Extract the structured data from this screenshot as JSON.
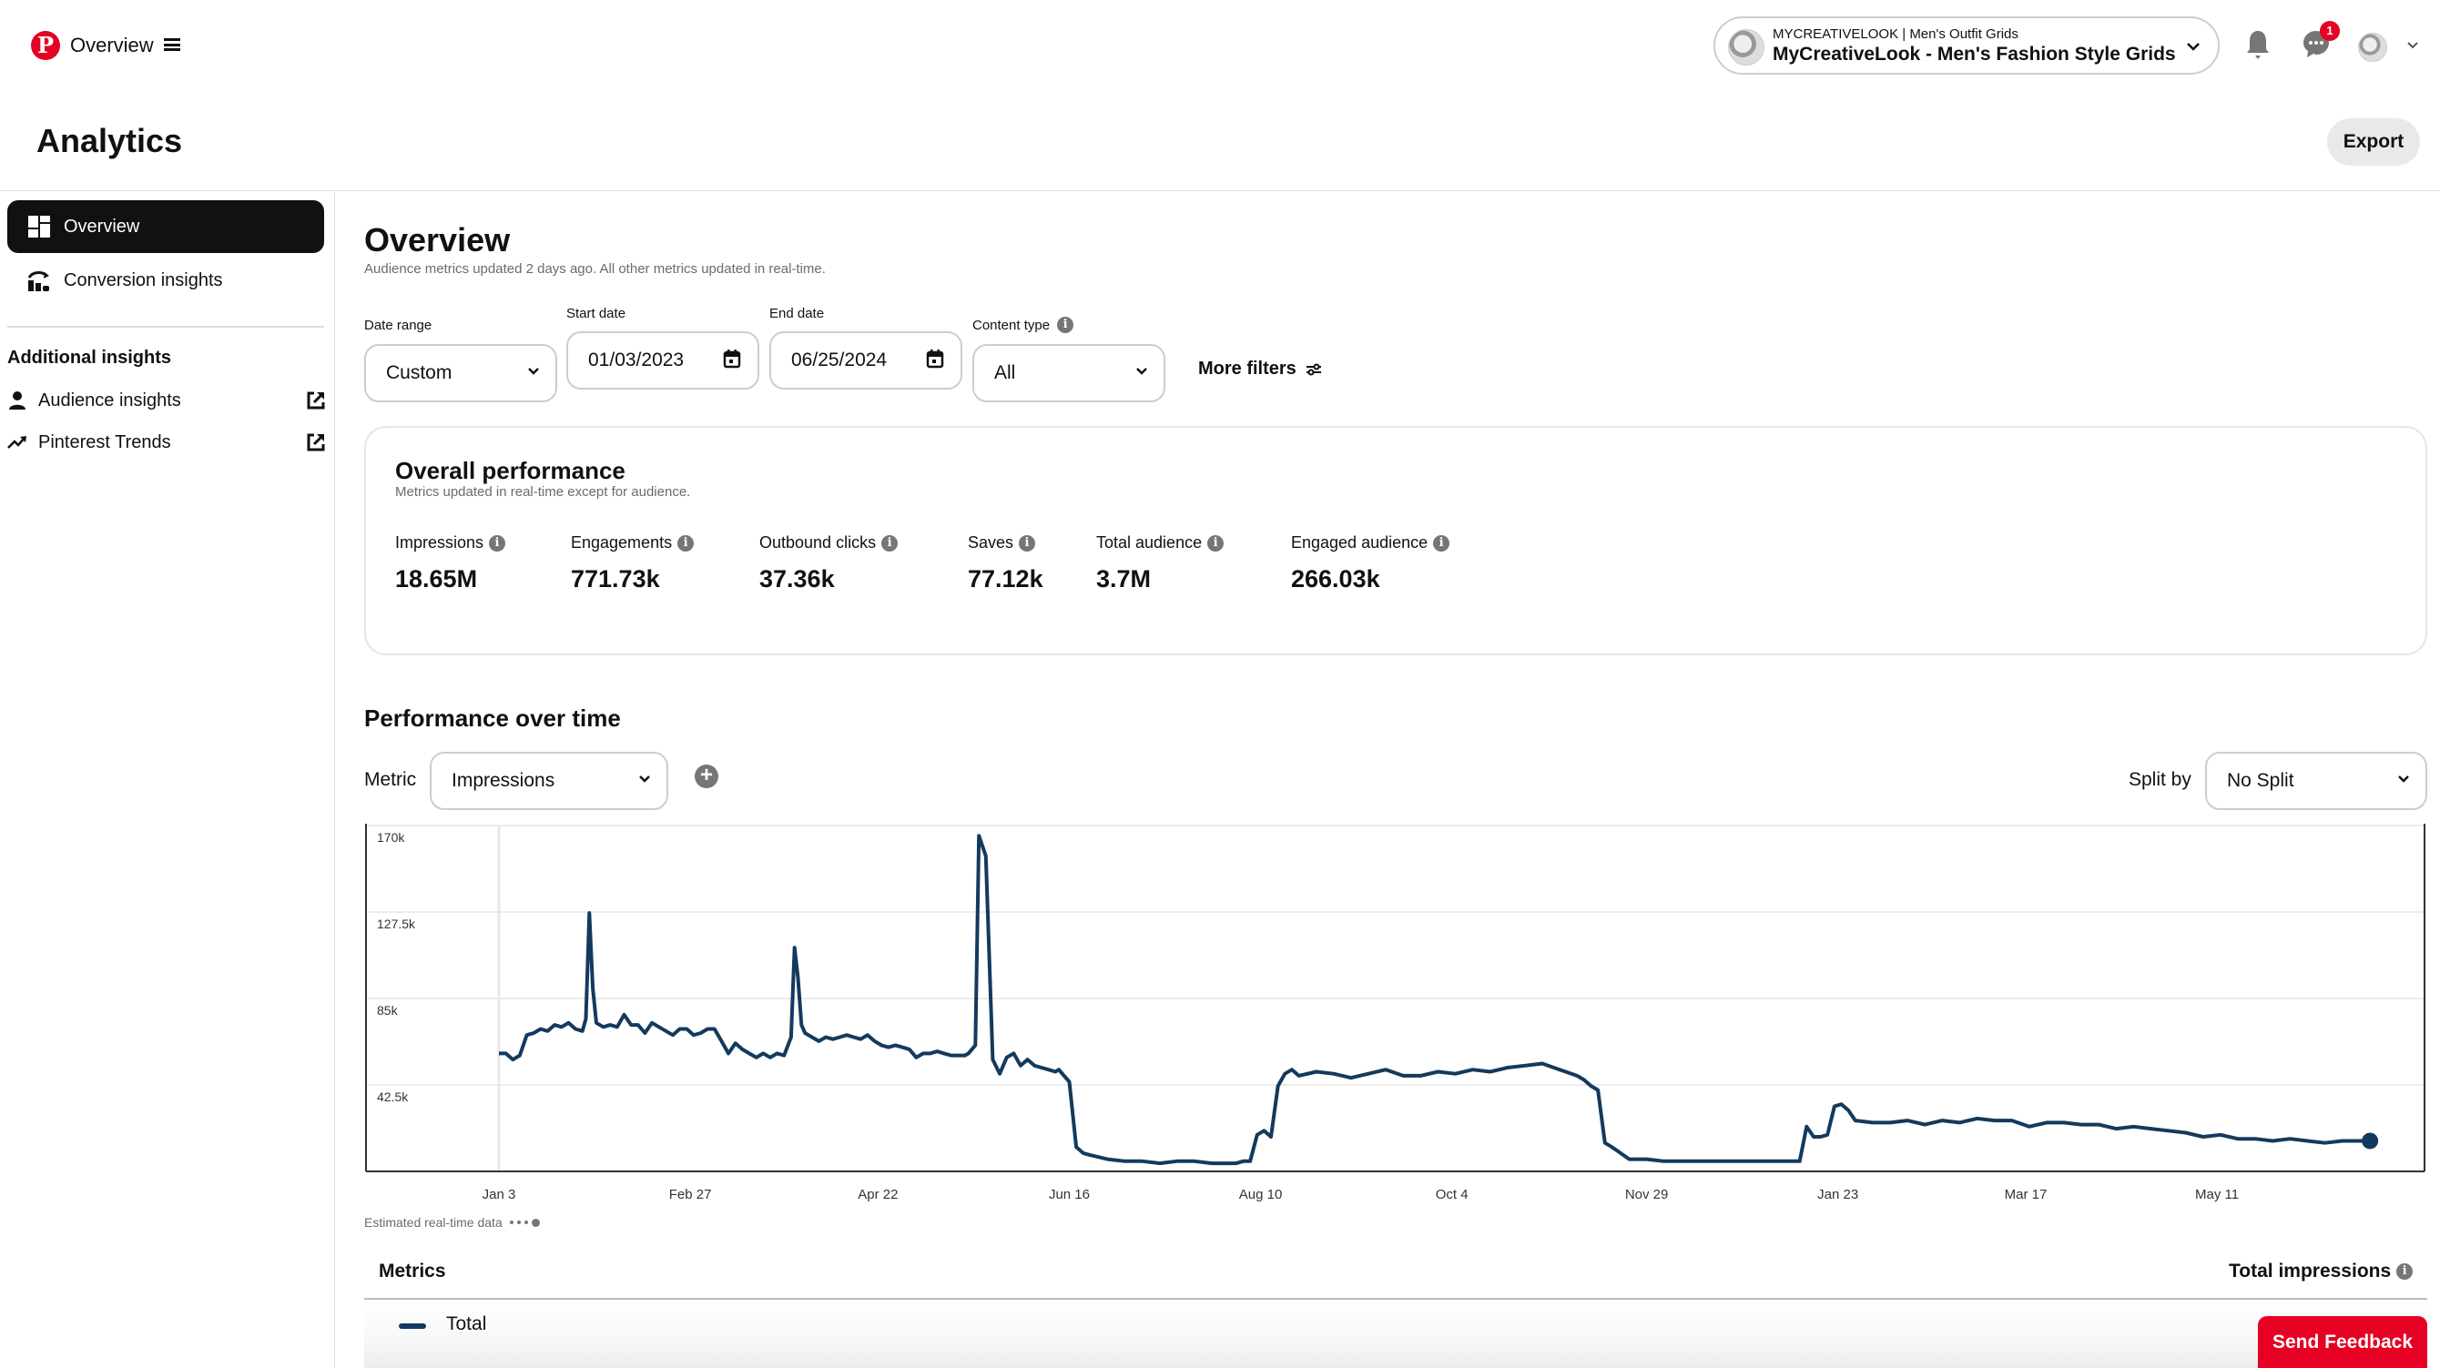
{
  "topbar": {
    "title": "Overview",
    "account": {
      "small": "MYCREATIVELOOK | Men's Outfit Grids",
      "name": "MyCreativeLook - Men's Fashion Style Grids"
    },
    "notification_badge": "1",
    "icons": [
      "pinterest-logo-icon",
      "menu-icon",
      "chevron-down-icon",
      "bell-icon",
      "chat-icon",
      "avatar"
    ]
  },
  "header": {
    "title": "Analytics",
    "export_label": "Export"
  },
  "sidebar": {
    "items": [
      {
        "label": "Overview",
        "icon": "dashboard-icon",
        "active": true
      },
      {
        "label": "Conversion insights",
        "icon": "conversion-icon",
        "active": false
      }
    ],
    "additional_heading": "Additional insights",
    "external": [
      {
        "label": "Audience insights",
        "icon": "person-icon"
      },
      {
        "label": "Pinterest Trends",
        "icon": "trend-icon"
      }
    ]
  },
  "main": {
    "title": "Overview",
    "subtitle": "Audience metrics updated 2 days ago. All other metrics updated in real-time.",
    "filters": {
      "date_range": {
        "label": "Date range",
        "value": "Custom"
      },
      "start_date": {
        "label": "Start date",
        "value": "01/03/2023"
      },
      "end_date": {
        "label": "End date",
        "value": "06/25/2024"
      },
      "content_type": {
        "label": "Content type",
        "value": "All"
      },
      "more_filters": "More filters"
    },
    "overall": {
      "title": "Overall performance",
      "subtitle": "Metrics updated in real-time except for audience.",
      "metrics": [
        {
          "label": "Impressions",
          "value": "18.65M"
        },
        {
          "label": "Engagements",
          "value": "771.73k"
        },
        {
          "label": "Outbound clicks",
          "value": "37.36k"
        },
        {
          "label": "Saves",
          "value": "77.12k"
        },
        {
          "label": "Total audience",
          "value": "3.7M"
        },
        {
          "label": "Engaged audience",
          "value": "266.03k"
        }
      ]
    },
    "performance": {
      "title": "Performance over time",
      "metric_label": "Metric",
      "metric_value": "Impressions",
      "split_label": "Split by",
      "split_value": "No Split",
      "estimated_note": "Estimated real-time data",
      "table": {
        "metrics_header": "Metrics",
        "total_header": "Total impressions",
        "rows": [
          {
            "label": "Total"
          }
        ]
      }
    },
    "feedback_label": "Send Feedback"
  },
  "colors": {
    "brand": "#e60023",
    "line": "#133a5e"
  },
  "chart_data": {
    "type": "line",
    "title": "Performance over time",
    "xlabel": "",
    "ylabel": "Impressions",
    "ylim": [
      0,
      170000
    ],
    "yticks": [
      "170k",
      "127.5k",
      "85k",
      "42.5k"
    ],
    "ytick_values": [
      170000,
      127500,
      85000,
      42500
    ],
    "xticks": [
      "Jan 3",
      "Feb 27",
      "Apr 22",
      "Jun 16",
      "Aug 10",
      "Oct 4",
      "Nov 29",
      "Jan 23",
      "Mar 17",
      "May 11"
    ],
    "xtick_days": [
      0,
      55,
      109,
      164,
      219,
      274,
      330,
      385,
      439,
      494
    ],
    "x_start": "2023-01-03",
    "x_end": "2024-06-25",
    "grid": true,
    "legend": "bottom",
    "series": [
      {
        "name": "Total",
        "x_days": [
          0,
          2,
          4,
          6,
          8,
          10,
          12,
          14,
          16,
          18,
          20,
          22,
          24,
          25,
          26,
          27,
          28,
          30,
          32,
          34,
          36,
          38,
          40,
          42,
          44,
          46,
          48,
          50,
          52,
          54,
          56,
          58,
          60,
          62,
          64,
          66,
          68,
          70,
          72,
          74,
          76,
          78,
          80,
          82,
          84,
          85,
          86,
          87,
          88,
          90,
          92,
          94,
          96,
          98,
          100,
          102,
          104,
          106,
          108,
          110,
          112,
          114,
          116,
          118,
          120,
          122,
          124,
          126,
          128,
          130,
          132,
          134,
          135,
          136,
          137,
          138,
          140,
          142,
          144,
          146,
          148,
          150,
          152,
          154,
          156,
          158,
          160,
          161,
          162,
          164,
          166,
          168,
          170,
          175,
          180,
          185,
          190,
          195,
          200,
          205,
          210,
          212,
          214,
          215,
          216,
          218,
          220,
          222,
          224,
          226,
          228,
          230,
          235,
          240,
          245,
          250,
          255,
          260,
          265,
          270,
          275,
          280,
          285,
          290,
          295,
          300,
          305,
          310,
          312,
          314,
          316,
          318,
          320,
          325,
          330,
          335,
          340,
          345,
          350,
          355,
          360,
          365,
          368,
          370,
          372,
          374,
          376,
          378,
          380,
          382,
          384,
          386,
          388,
          390,
          395,
          400,
          405,
          410,
          415,
          420,
          425,
          430,
          435,
          440,
          445,
          450,
          455,
          460,
          465,
          470,
          475,
          480,
          485,
          490,
          495,
          500,
          505,
          510,
          515,
          520,
          525,
          530,
          535,
          538
        ],
        "values": [
          58,
          58,
          55,
          57,
          67,
          68,
          70,
          69,
          72,
          71,
          73,
          70,
          69,
          75,
          127,
          90,
          73,
          71,
          72,
          71,
          77,
          72,
          72,
          68,
          73,
          71,
          69,
          67,
          70,
          70,
          67,
          68,
          70,
          70,
          64,
          58,
          63,
          60,
          58,
          56,
          58,
          56,
          58,
          57,
          66,
          110,
          95,
          72,
          68,
          66,
          64,
          66,
          65,
          66,
          67,
          66,
          65,
          67,
          64,
          62,
          61,
          62,
          61,
          60,
          56,
          58,
          58,
          59,
          58,
          57,
          57,
          57,
          58,
          60,
          62,
          165,
          155,
          55,
          48,
          56,
          58,
          52,
          55,
          52,
          51,
          50,
          49,
          50,
          48,
          44,
          12,
          9,
          8,
          6,
          5,
          5,
          4,
          5,
          5,
          4,
          4,
          4,
          5,
          5,
          5,
          18,
          20,
          17,
          42,
          48,
          50,
          47,
          49,
          48,
          46,
          48,
          50,
          47,
          47,
          49,
          48,
          50,
          49,
          51,
          52,
          53,
          50,
          47,
          45,
          42,
          40,
          14,
          12,
          6,
          6,
          5,
          5,
          5,
          5,
          5,
          5,
          5,
          5,
          5,
          5,
          5,
          22,
          17,
          17,
          18,
          32,
          33,
          30,
          25,
          24,
          24,
          25,
          23,
          25,
          24,
          26,
          25,
          25,
          22,
          24,
          24,
          23,
          23,
          21,
          22,
          21,
          20,
          19,
          17,
          18,
          16,
          16,
          15,
          16,
          15,
          14,
          15,
          15,
          15,
          15
        ]
      }
    ]
  }
}
